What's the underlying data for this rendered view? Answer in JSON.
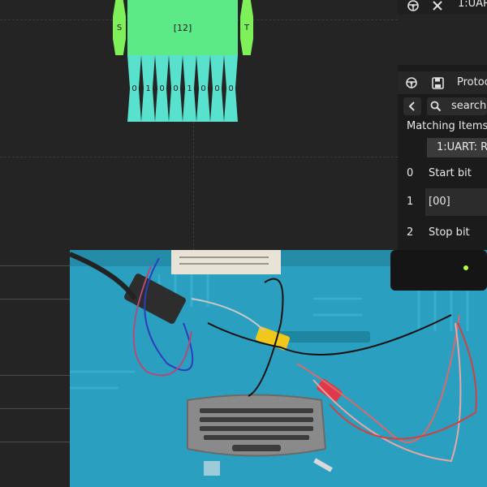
{
  "waveform": {
    "start_label": "S",
    "stop_label": "T",
    "byte_label": "[12]",
    "bits": [
      "0",
      "1",
      "0",
      "0",
      "1",
      "0",
      "0",
      "0"
    ]
  },
  "top_panel": {
    "title": "1:UAR"
  },
  "protocol_panel": {
    "title": "Protoc",
    "search_placeholder": "search",
    "matching_label": "Matching Items",
    "filter_chip": "1:UART: R",
    "rows": [
      {
        "index": "0",
        "label": "Start bit"
      },
      {
        "index": "1",
        "label": "[00]"
      },
      {
        "index": "2",
        "label": "Stop bit"
      }
    ]
  },
  "colors": {
    "background": "#242424",
    "start_stop": "#7df05a",
    "data_byte": "#5cea86",
    "data_bit": "#58e1cc",
    "mat": "#2a9fc0"
  },
  "icons": {
    "decoder": "steering-wheel-icon",
    "close": "close-icon",
    "save": "save-icon",
    "back": "chevron-left-icon",
    "search": "search-icon"
  }
}
